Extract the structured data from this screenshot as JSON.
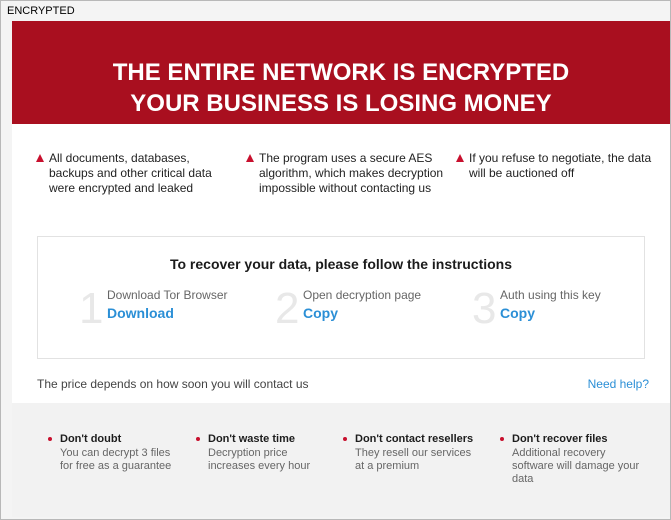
{
  "window": {
    "title": "ENCRYPTED"
  },
  "banner": {
    "line1": "THE ENTIRE NETWORK IS ENCRYPTED",
    "line2": "YOUR BUSINESS IS LOSING MONEY"
  },
  "warnings": [
    {
      "text": "All documents, databases, backups and other critical data were encrypted and leaked"
    },
    {
      "text": "The program uses a secure AES algorithm, which makes decryption impossible without contacting us"
    },
    {
      "text": "If you refuse to negotiate, the data will be auctioned off"
    }
  ],
  "instructions": {
    "heading": "To recover your data, please follow the instructions",
    "steps": [
      {
        "number": "1",
        "label": "Download Tor Browser",
        "link": "Download"
      },
      {
        "number": "2",
        "label": "Open decryption page",
        "link": "Copy"
      },
      {
        "number": "3",
        "label": "Auth using this key",
        "link": "Copy"
      }
    ]
  },
  "price_text": "The price depends on how soon you will contact us",
  "need_help": "Need help?",
  "tips": [
    {
      "title": "Don't doubt",
      "desc": "You can decrypt 3 files for free as a guarantee"
    },
    {
      "title": "Don't waste time",
      "desc": "Decryption price increases every hour"
    },
    {
      "title": "Don't contact resellers",
      "desc": "They resell our services at a premium"
    },
    {
      "title": "Don't recover files",
      "desc": "Additional recovery software will damage your data"
    }
  ],
  "colors": {
    "banner": "#a90f1f",
    "accent_red": "#c8102e",
    "link_blue": "#2b8fd6"
  }
}
